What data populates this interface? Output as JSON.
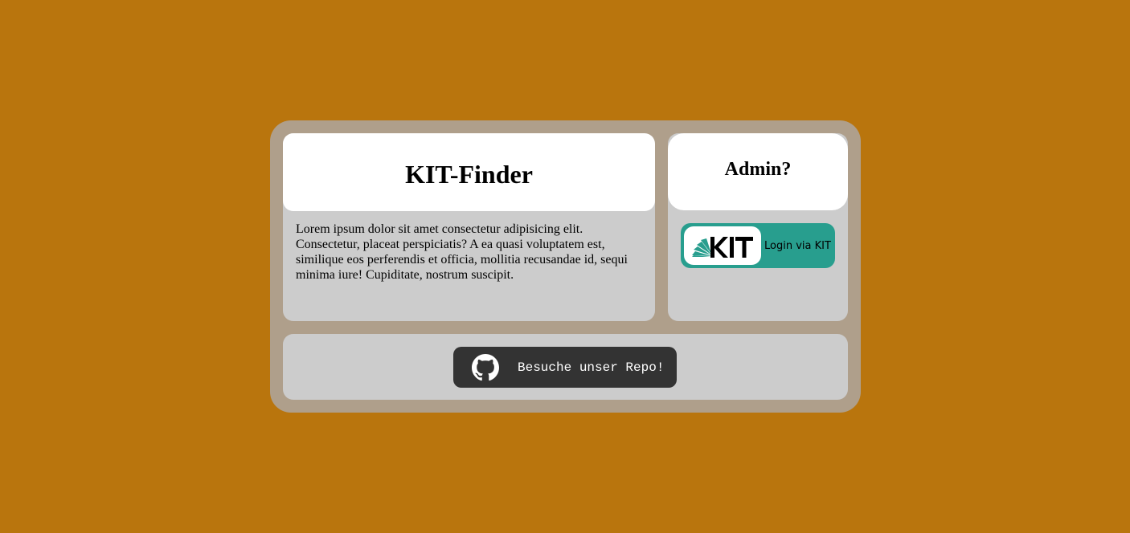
{
  "main": {
    "title": "KIT-Finder",
    "description": "Lorem ipsum dolor sit amet consectetur adipisicing elit. Consectetur, placeat perspiciatis? A ea quasi voluptatem est, similique eos perferendis et officia, mollitia recusandae id, sequi minima iure! Cupiditate, nostrum suscipit."
  },
  "admin": {
    "title": "Admin?",
    "login_button": {
      "logo_text": "KIT",
      "label": "Login via KIT",
      "icon": "kit-logo-icon"
    }
  },
  "footer": {
    "repo_button": {
      "label": "Besuche unser Repo!",
      "icon": "github-icon"
    }
  },
  "colors": {
    "background": "#b9750d",
    "frame": "#af9f8b",
    "card": "#cccccc",
    "kit_green": "#289e8e",
    "repo_button": "#333333"
  }
}
